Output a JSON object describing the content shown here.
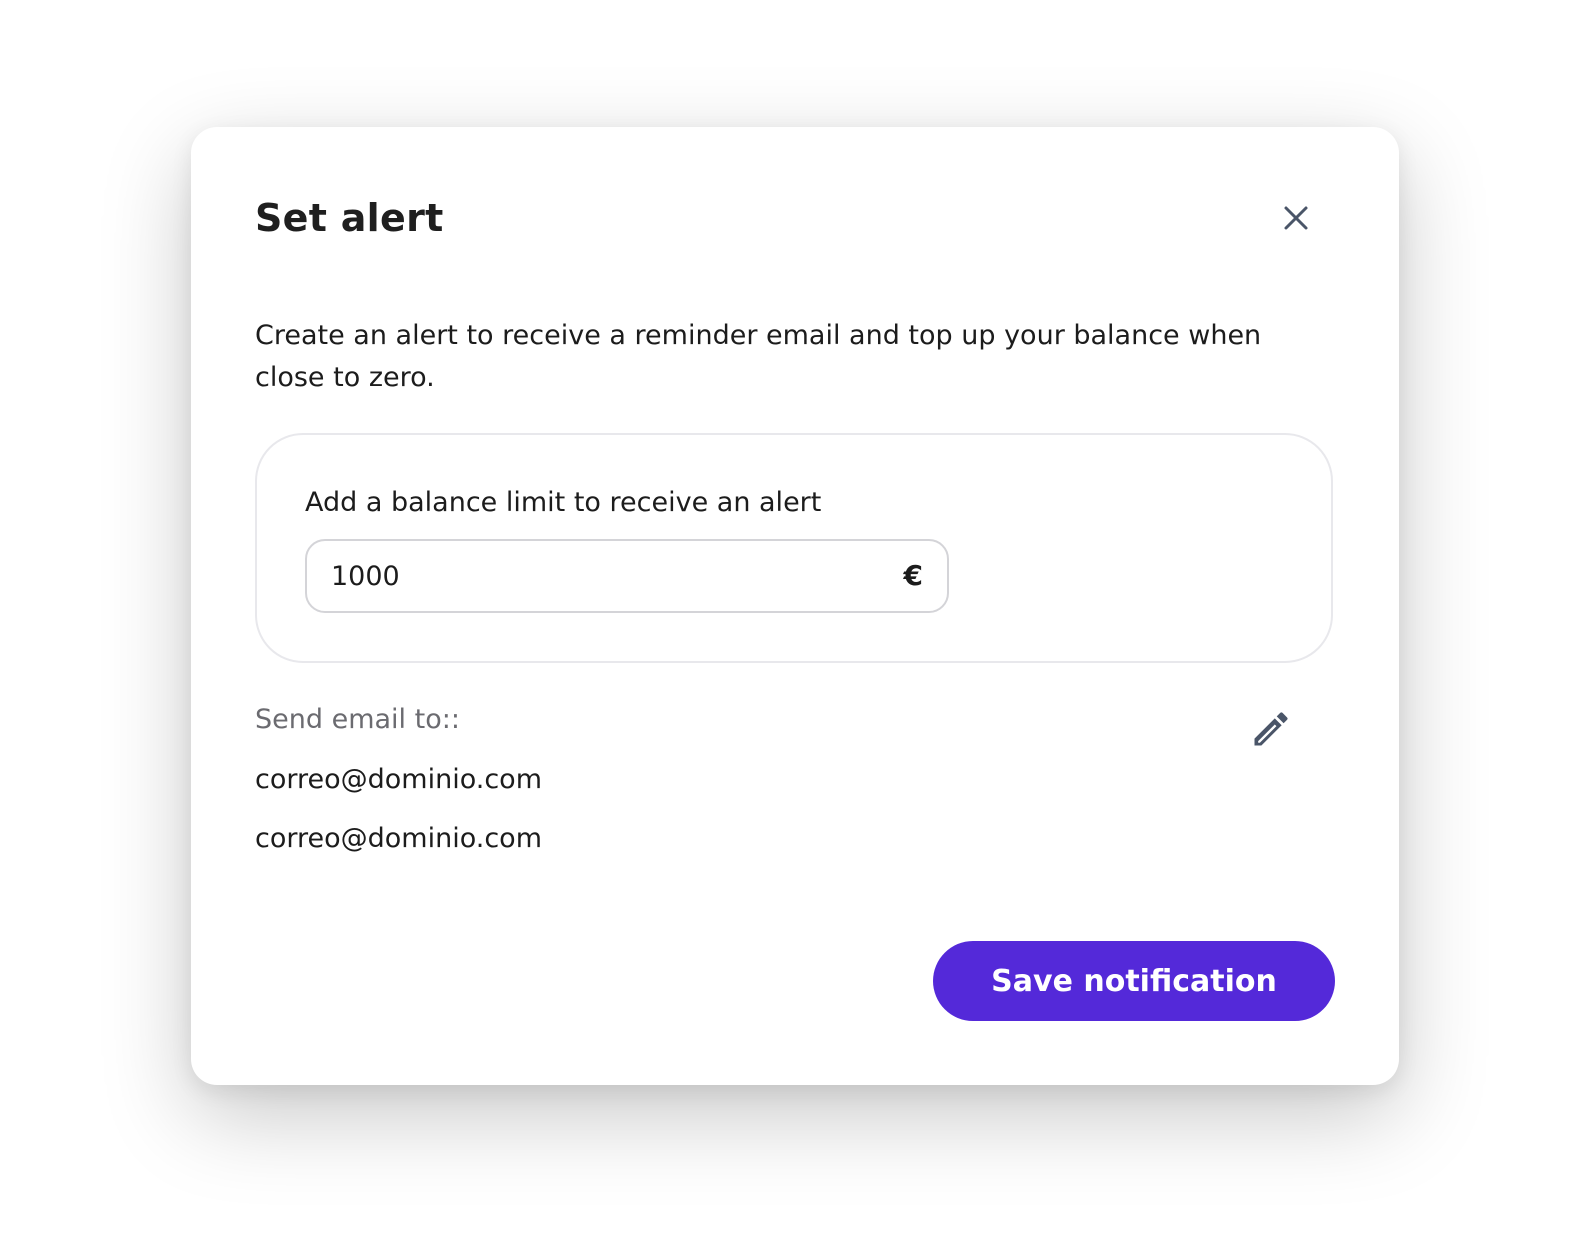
{
  "dialog": {
    "title": "Set alert",
    "close_icon": "close-icon",
    "description": "Create an alert to receive a reminder email and top up your balance when close to zero.",
    "limit": {
      "label": "Add a balance limit to receive an alert",
      "value": "1000",
      "currency": "€"
    },
    "recipients": {
      "label": "Send email to::",
      "edit_icon": "pencil-icon",
      "emails": [
        "correo@dominio.com",
        "correo@dominio.com"
      ]
    },
    "save_label": "Save notification"
  },
  "colors": {
    "accent": "#5429D9",
    "title_text": "#1F1F1F",
    "muted_text": "#6B6B70",
    "icon": "#4A5568",
    "card_border": "#E8E8EC",
    "field_border": "#D4D4D8"
  }
}
